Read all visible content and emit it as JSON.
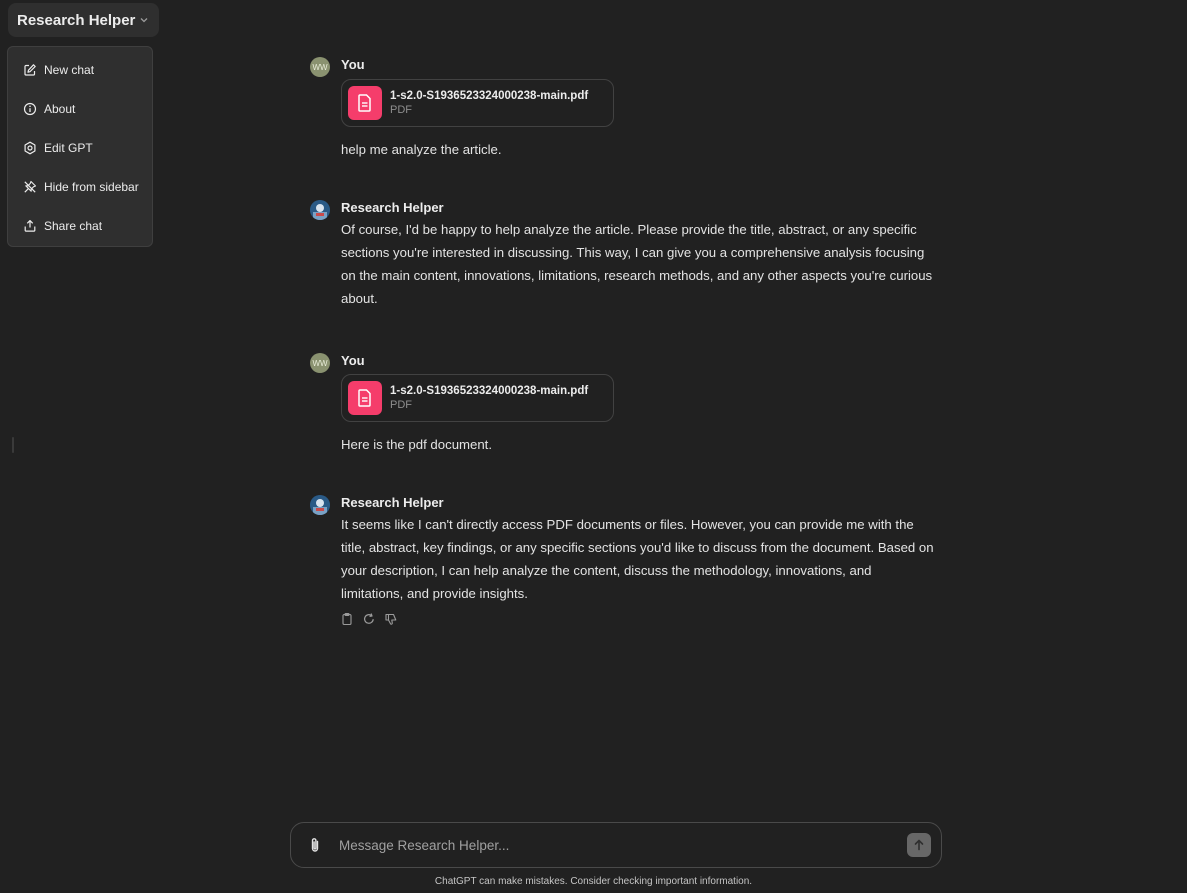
{
  "header": {
    "model_title": "Research Helper"
  },
  "menu": {
    "items": [
      {
        "label": "New chat",
        "icon": "edit-icon"
      },
      {
        "label": "About",
        "icon": "info-icon"
      },
      {
        "label": "Edit GPT",
        "icon": "gear-icon"
      },
      {
        "label": "Hide from sidebar",
        "icon": "unpin-icon"
      },
      {
        "label": "Share chat",
        "icon": "share-icon"
      }
    ]
  },
  "messages": [
    {
      "author": "You",
      "avatar_initials": "WW",
      "file": {
        "name": "1-s2.0-S1936523324000238-main.pdf",
        "type": "PDF"
      },
      "text": "help me analyze the article."
    },
    {
      "author": "Research Helper",
      "text": "Of course, I'd be happy to help analyze the article. Please provide the title, abstract, or any specific sections you're interested in discussing. This way, I can give you a comprehensive analysis focusing on the main content, innovations, limitations, research methods, and any other aspects you're curious about."
    },
    {
      "author": "You",
      "avatar_initials": "WW",
      "file": {
        "name": "1-s2.0-S1936523324000238-main.pdf",
        "type": "PDF"
      },
      "text": "Here is the pdf document."
    },
    {
      "author": "Research Helper",
      "text": "It seems like I can't directly access PDF documents or files. However, you can provide me with the title, abstract, key findings, or any specific sections you'd like to discuss from the document. Based on your description, I can help analyze the content, discuss the methodology, innovations, and limitations, and provide insights."
    }
  ],
  "composer": {
    "placeholder": "Message Research Helper..."
  },
  "footer": {
    "note": "ChatGPT can make mistakes. Consider checking important information."
  },
  "colors": {
    "background": "#212121",
    "pdf_icon": "#f53d6b",
    "menu_bg": "#2f2f2f"
  }
}
